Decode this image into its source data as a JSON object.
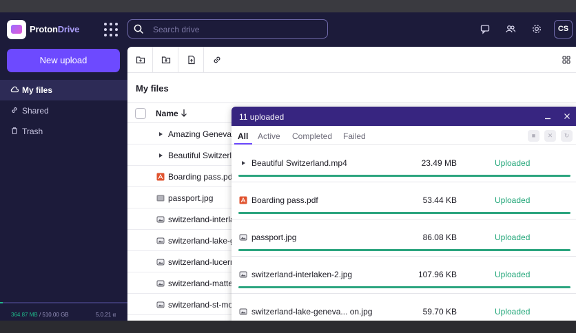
{
  "header": {
    "brand_name": "Proton",
    "brand_product": "Drive",
    "search_placeholder": "Search drive",
    "avatar_initials": "CS"
  },
  "sidebar": {
    "new_upload_label": "New upload",
    "items": [
      {
        "label": "My files",
        "icon": "cloud-icon",
        "active": true
      },
      {
        "label": "Shared",
        "icon": "link-icon",
        "active": false
      },
      {
        "label": "Trash",
        "icon": "trash-icon",
        "active": false
      }
    ],
    "storage_used": "364.87 MB",
    "storage_total": "/ 510.00 GB",
    "storage_fraction": 0.0007,
    "version": "5.0.21 α"
  },
  "main": {
    "title": "My files",
    "column_name": "Name",
    "files": [
      {
        "name": "Amazing Geneva.m",
        "icon": "video-icon"
      },
      {
        "name": "Beautiful Switzerla",
        "icon": "video-icon"
      },
      {
        "name": "Boarding pass.pdf",
        "icon": "pdf-icon"
      },
      {
        "name": "passport.jpg",
        "icon": "image-thumb-icon"
      },
      {
        "name": "switzerland-interla",
        "icon": "image-icon"
      },
      {
        "name": "switzerland-lake-g",
        "icon": "image-icon"
      },
      {
        "name": "switzerland-lucerr",
        "icon": "image-icon"
      },
      {
        "name": "switzerland-matte",
        "icon": "image-icon"
      },
      {
        "name": "switzerland-st-mo",
        "icon": "image-icon"
      }
    ]
  },
  "transfers": {
    "title": "11 uploaded",
    "tabs": [
      "All",
      "Active",
      "Completed",
      "Failed"
    ],
    "active_tab": "All",
    "items": [
      {
        "name": "Beautiful Switzerland.mp4",
        "size": "23.49 MB",
        "status": "Uploaded",
        "icon": "video-icon",
        "progress": 1.0
      },
      {
        "name": "Boarding pass.pdf",
        "size": "53.44 KB",
        "status": "Uploaded",
        "icon": "pdf-icon",
        "progress": 1.0
      },
      {
        "name": "passport.jpg",
        "size": "86.08 KB",
        "status": "Uploaded",
        "icon": "image-icon",
        "progress": 1.0
      },
      {
        "name": "switzerland-interlaken-2.jpg",
        "size": "107.96 KB",
        "status": "Uploaded",
        "icon": "image-icon",
        "progress": 1.0
      },
      {
        "name": "switzerland-lake-geneva... on.jpg",
        "size": "59.70 KB",
        "status": "Uploaded",
        "icon": "image-icon",
        "progress": 1.0
      }
    ]
  },
  "colors": {
    "accent": "#6d4aff",
    "sidebar_bg": "#1c1b3a",
    "success": "#1fa577",
    "transfer_header": "#372580"
  }
}
